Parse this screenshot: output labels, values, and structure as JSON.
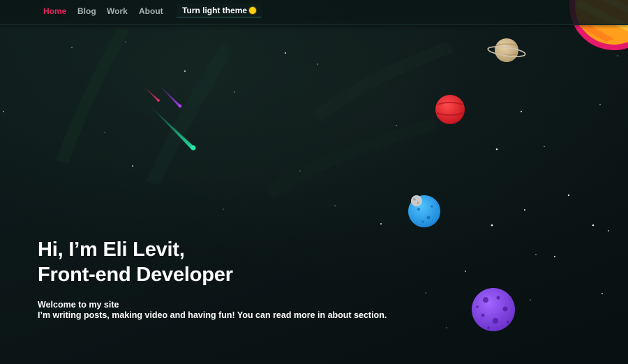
{
  "nav": {
    "items": [
      {
        "label": "Home",
        "active": true
      },
      {
        "label": "Blog",
        "active": false
      },
      {
        "label": "Work",
        "active": false
      },
      {
        "label": "About",
        "active": false
      }
    ],
    "theme_toggle_label": "Turn light theme",
    "theme_toggle_icon": "sun-icon",
    "active_color": "#e8245f"
  },
  "hero": {
    "title_line1": "Hi, I’m Eli Levit,",
    "title_line2": "Front-end Developer",
    "subtitle_line1": "Welcome to my site",
    "subtitle_line2": "I’m writing posts, making video and having fun! You can read more in about section."
  },
  "colors": {
    "background": "#0b1416",
    "text": "#ffffff",
    "nav_text": "#a7b0b3",
    "sun": "#ffd10a"
  }
}
